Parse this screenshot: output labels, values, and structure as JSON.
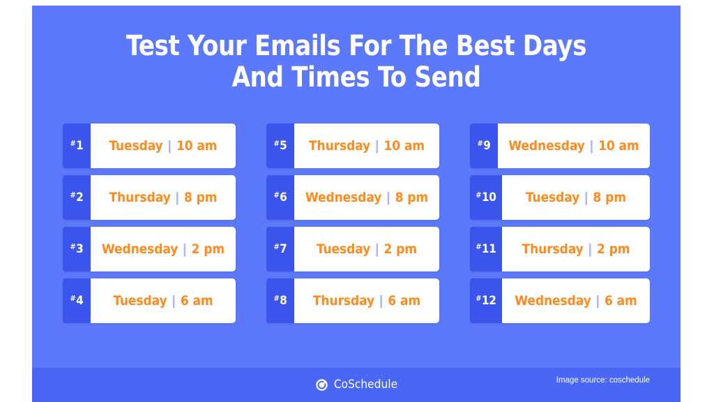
{
  "panel": {
    "background_color": "#5c79fb",
    "badge_color": "#3b54ec",
    "footer_color": "#4a66f4",
    "accent_color": "#ff8a1e",
    "separator_color": "#a8b6fb"
  },
  "title": {
    "line1": "Test Your Emails For The Best Days",
    "line2": "And Times To Send"
  },
  "separator": "|",
  "columns": [
    {
      "cards": [
        {
          "rank_hash": "#",
          "rank": "1",
          "day": "Tuesday",
          "time": "10 am"
        },
        {
          "rank_hash": "#",
          "rank": "2",
          "day": "Thursday",
          "time": "8 pm"
        },
        {
          "rank_hash": "#",
          "rank": "3",
          "day": "Wednesday",
          "time": "2 pm"
        },
        {
          "rank_hash": "#",
          "rank": "4",
          "day": "Tuesday",
          "time": "6 am"
        }
      ]
    },
    {
      "cards": [
        {
          "rank_hash": "#",
          "rank": "5",
          "day": "Thursday",
          "time": "10 am"
        },
        {
          "rank_hash": "#",
          "rank": "6",
          "day": "Wednesday",
          "time": "8 pm"
        },
        {
          "rank_hash": "#",
          "rank": "7",
          "day": "Tuesday",
          "time": "2 pm"
        },
        {
          "rank_hash": "#",
          "rank": "8",
          "day": "Thursday",
          "time": "6 am"
        }
      ]
    },
    {
      "cards": [
        {
          "rank_hash": "#",
          "rank": "9",
          "day": "Wednesday",
          "time": "10 am"
        },
        {
          "rank_hash": "#",
          "rank": "10",
          "day": "Tuesday",
          "time": "8 pm"
        },
        {
          "rank_hash": "#",
          "rank": "11",
          "day": "Thursday",
          "time": "2 pm"
        },
        {
          "rank_hash": "#",
          "rank": "12",
          "day": "Wednesday",
          "time": "6 am"
        }
      ]
    }
  ],
  "footer": {
    "logo_icon": "coschedule-check-circle-icon",
    "logo_text": "CoSchedule",
    "attribution": "Image source: coschedule"
  }
}
